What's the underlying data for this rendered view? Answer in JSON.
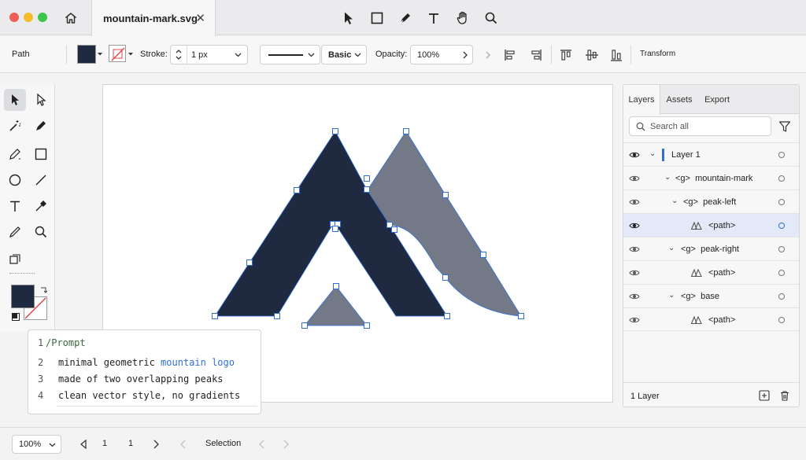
{
  "window": {
    "tab_title": "mountain-mark.svg",
    "close_glyph": "✕",
    "traffic_lights": {
      "close": "#ee5f57",
      "minimize": "#f5bd2e",
      "zoom": "#3dc44a"
    }
  },
  "top_tools": [
    "select-arrow-icon",
    "rectangle-icon",
    "pen-icon",
    "text-icon",
    "hand-icon",
    "zoom-icon"
  ],
  "props": {
    "selection_type": "Path",
    "fill_color": "#1f2a40",
    "stroke_label": "Stroke:",
    "stroke_width": "1 px",
    "line_style": "Basic",
    "opacity_label": "Opacity:",
    "opacity_value": "100%",
    "transform_label": "Transform"
  },
  "prompt": {
    "header_num": "1",
    "header_text": "/Prompt",
    "lines": [
      {
        "num": "2",
        "pre": "minimal geometric ",
        "highlight": "mountain logo"
      },
      {
        "num": "3",
        "text": "made of two overlapping peaks"
      },
      {
        "num": "4",
        "text": "clean vector style, no gradients"
      }
    ]
  },
  "artwork": {
    "colors": {
      "dark_peak": "#1f2a40",
      "gray_peak": "#737987",
      "base": "#737987",
      "selection": "#2f6fd6"
    }
  },
  "panel": {
    "tabs": {
      "layers": "Layers",
      "assets": "Assets",
      "export": "Export"
    },
    "search_placeholder": "Search all",
    "layers": [
      {
        "label": "Layer 1",
        "accent": "#2f6fd6"
      },
      {
        "label": "<g>  mountain-mark"
      },
      {
        "label": "<g>  peak-left"
      },
      {
        "label": "<path>",
        "selected": true
      },
      {
        "label": "<g>  peak-right"
      },
      {
        "label": "<path>"
      },
      {
        "label": "<g>  base"
      },
      {
        "label": "<path>"
      }
    ],
    "footer": "1 Layer"
  },
  "status": {
    "zoom": "100%",
    "page_current": "1",
    "page_total": "1",
    "mode": "Selection"
  }
}
